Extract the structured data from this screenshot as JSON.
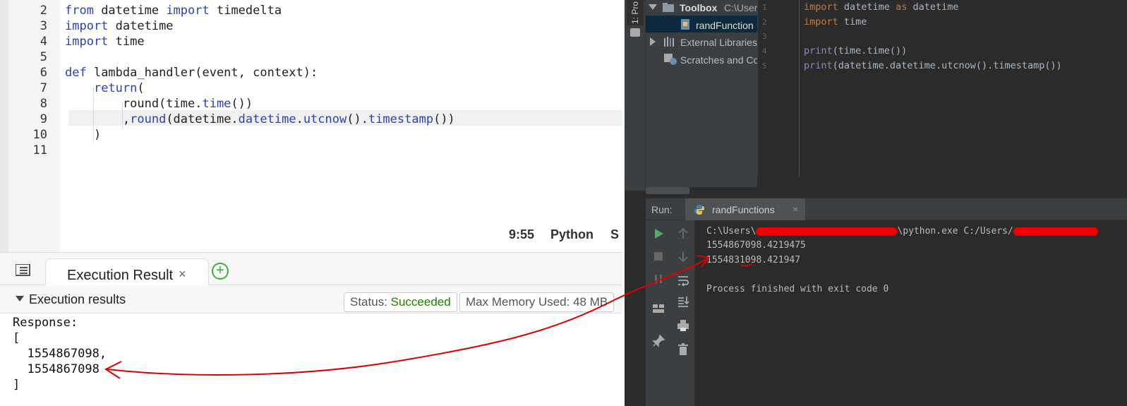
{
  "left_editor": {
    "line_numbers": [
      "2",
      "3",
      "4",
      "5",
      "6",
      "7",
      "8",
      "9",
      "10",
      "11"
    ],
    "lines": [
      [
        {
          "t": "from",
          "k": "kw"
        },
        {
          "t": " datetime "
        },
        {
          "t": "import",
          "k": "kw"
        },
        {
          "t": " timedelta"
        }
      ],
      [
        {
          "t": "import",
          "k": "kw"
        },
        {
          "t": " datetime"
        }
      ],
      [
        {
          "t": "import",
          "k": "kw"
        },
        {
          "t": " time"
        }
      ],
      [],
      [
        {
          "t": "def",
          "k": "kw"
        },
        {
          "t": " lambda_handler(event, context):"
        }
      ],
      [
        {
          "t": "    "
        },
        {
          "t": "return",
          "k": "kw"
        },
        {
          "t": "("
        }
      ],
      [
        {
          "t": "        round(time."
        },
        {
          "t": "time",
          "k": "fn"
        },
        {
          "t": "())"
        }
      ],
      [
        {
          "t": "        ,"
        },
        {
          "t": "round",
          "k": "fn"
        },
        {
          "t": "(datetime."
        },
        {
          "t": "datetime",
          "k": "fn"
        },
        {
          "t": "."
        },
        {
          "t": "utcnow",
          "k": "fn"
        },
        {
          "t": "()."
        },
        {
          "t": "timestamp",
          "k": "fn"
        },
        {
          "t": "())"
        }
      ],
      [
        {
          "t": "    )"
        }
      ],
      []
    ],
    "cursor_position": "9:55",
    "language": "Python",
    "language_cut": "S"
  },
  "results_panel": {
    "tab_label": "Execution Result",
    "tab_close": "×",
    "add_tab": "+",
    "section_title": "Execution results",
    "status_label": "Status: ",
    "status_value": "Succeeded",
    "memory_label": "Max Memory Used: 48 MB",
    "response_lines": [
      "Response:",
      "[",
      "  1554867098,",
      "  1554867098",
      "]"
    ]
  },
  "pycharm": {
    "side_tab_label": "1: Pro",
    "project_tree": {
      "root_label": "Toolbox",
      "root_path": "C:\\User",
      "file": "randFunction",
      "external": "External Libraries",
      "scratches": "Scratches and Co"
    },
    "editor_line_numbers": [
      "1",
      "2",
      "3",
      "4",
      "5"
    ],
    "editor_lines": [
      [
        {
          "t": "import",
          "k": "kw"
        },
        {
          "t": " datetime "
        },
        {
          "t": "as",
          "k": "kw"
        },
        {
          "t": " datetime"
        }
      ],
      [
        {
          "t": "import",
          "k": "kw"
        },
        {
          "t": " time"
        }
      ],
      [],
      [
        {
          "t": "print",
          "k": "fn"
        },
        {
          "t": "(time.time())"
        }
      ],
      [
        {
          "t": "print",
          "k": "fn"
        },
        {
          "t": "(datetime.datetime.utcnow().timestamp())"
        }
      ]
    ],
    "run_label": "Run:",
    "run_tab": "randFunctions",
    "run_tab_close": "×",
    "console": {
      "cmd_prefix": "C:\\Users\\",
      "cmd_middle": "\\python.exe C:/Users/",
      "out1": "1554867098.4219475",
      "out2": "1554831098.421947",
      "exit": "Process finished with exit code 0"
    },
    "colors": {
      "keyword": "#cc7832",
      "builtin": "#8888c6",
      "text": "#a9b7c6",
      "annotation": "#e00000"
    }
  }
}
